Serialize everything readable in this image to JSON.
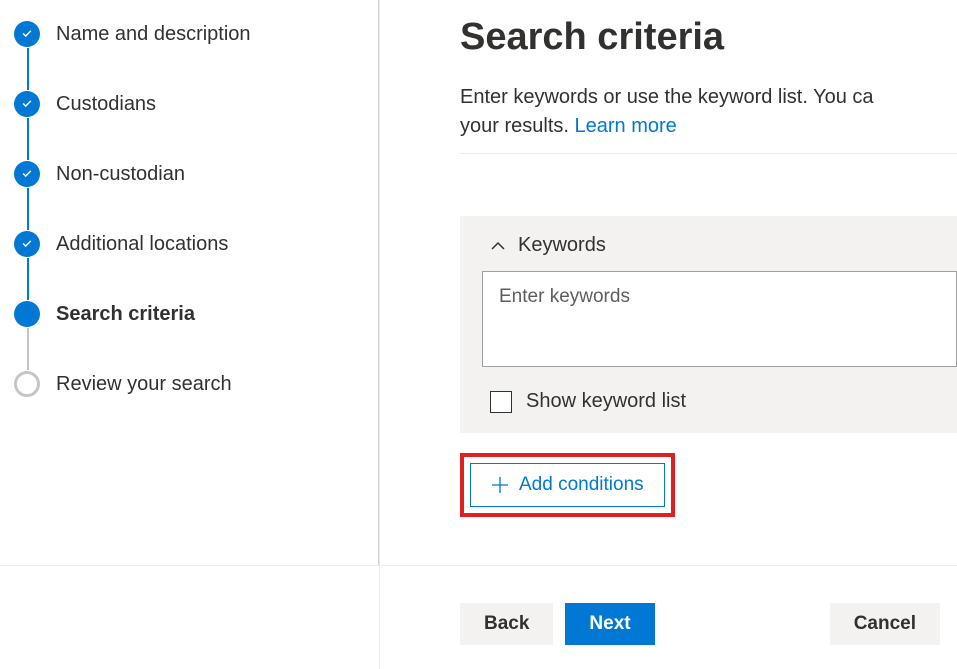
{
  "sidebar": {
    "steps": [
      {
        "label": "Name and description",
        "state": "completed"
      },
      {
        "label": "Custodians",
        "state": "completed"
      },
      {
        "label": "Non-custodian",
        "state": "completed"
      },
      {
        "label": "Additional locations",
        "state": "completed"
      },
      {
        "label": "Search criteria",
        "state": "current"
      },
      {
        "label": "Review your search",
        "state": "pending"
      }
    ]
  },
  "main": {
    "title": "Search criteria",
    "description_start": "Enter keywords or use the keyword list. You ca",
    "description_line2": "your results. ",
    "learn_more": "Learn more",
    "keywords_label": "Keywords",
    "keywords_placeholder": "Enter keywords",
    "show_keyword_list_label": "Show keyword list",
    "add_conditions_label": "Add conditions"
  },
  "footer": {
    "back_label": "Back",
    "next_label": "Next",
    "cancel_label": "Cancel"
  }
}
